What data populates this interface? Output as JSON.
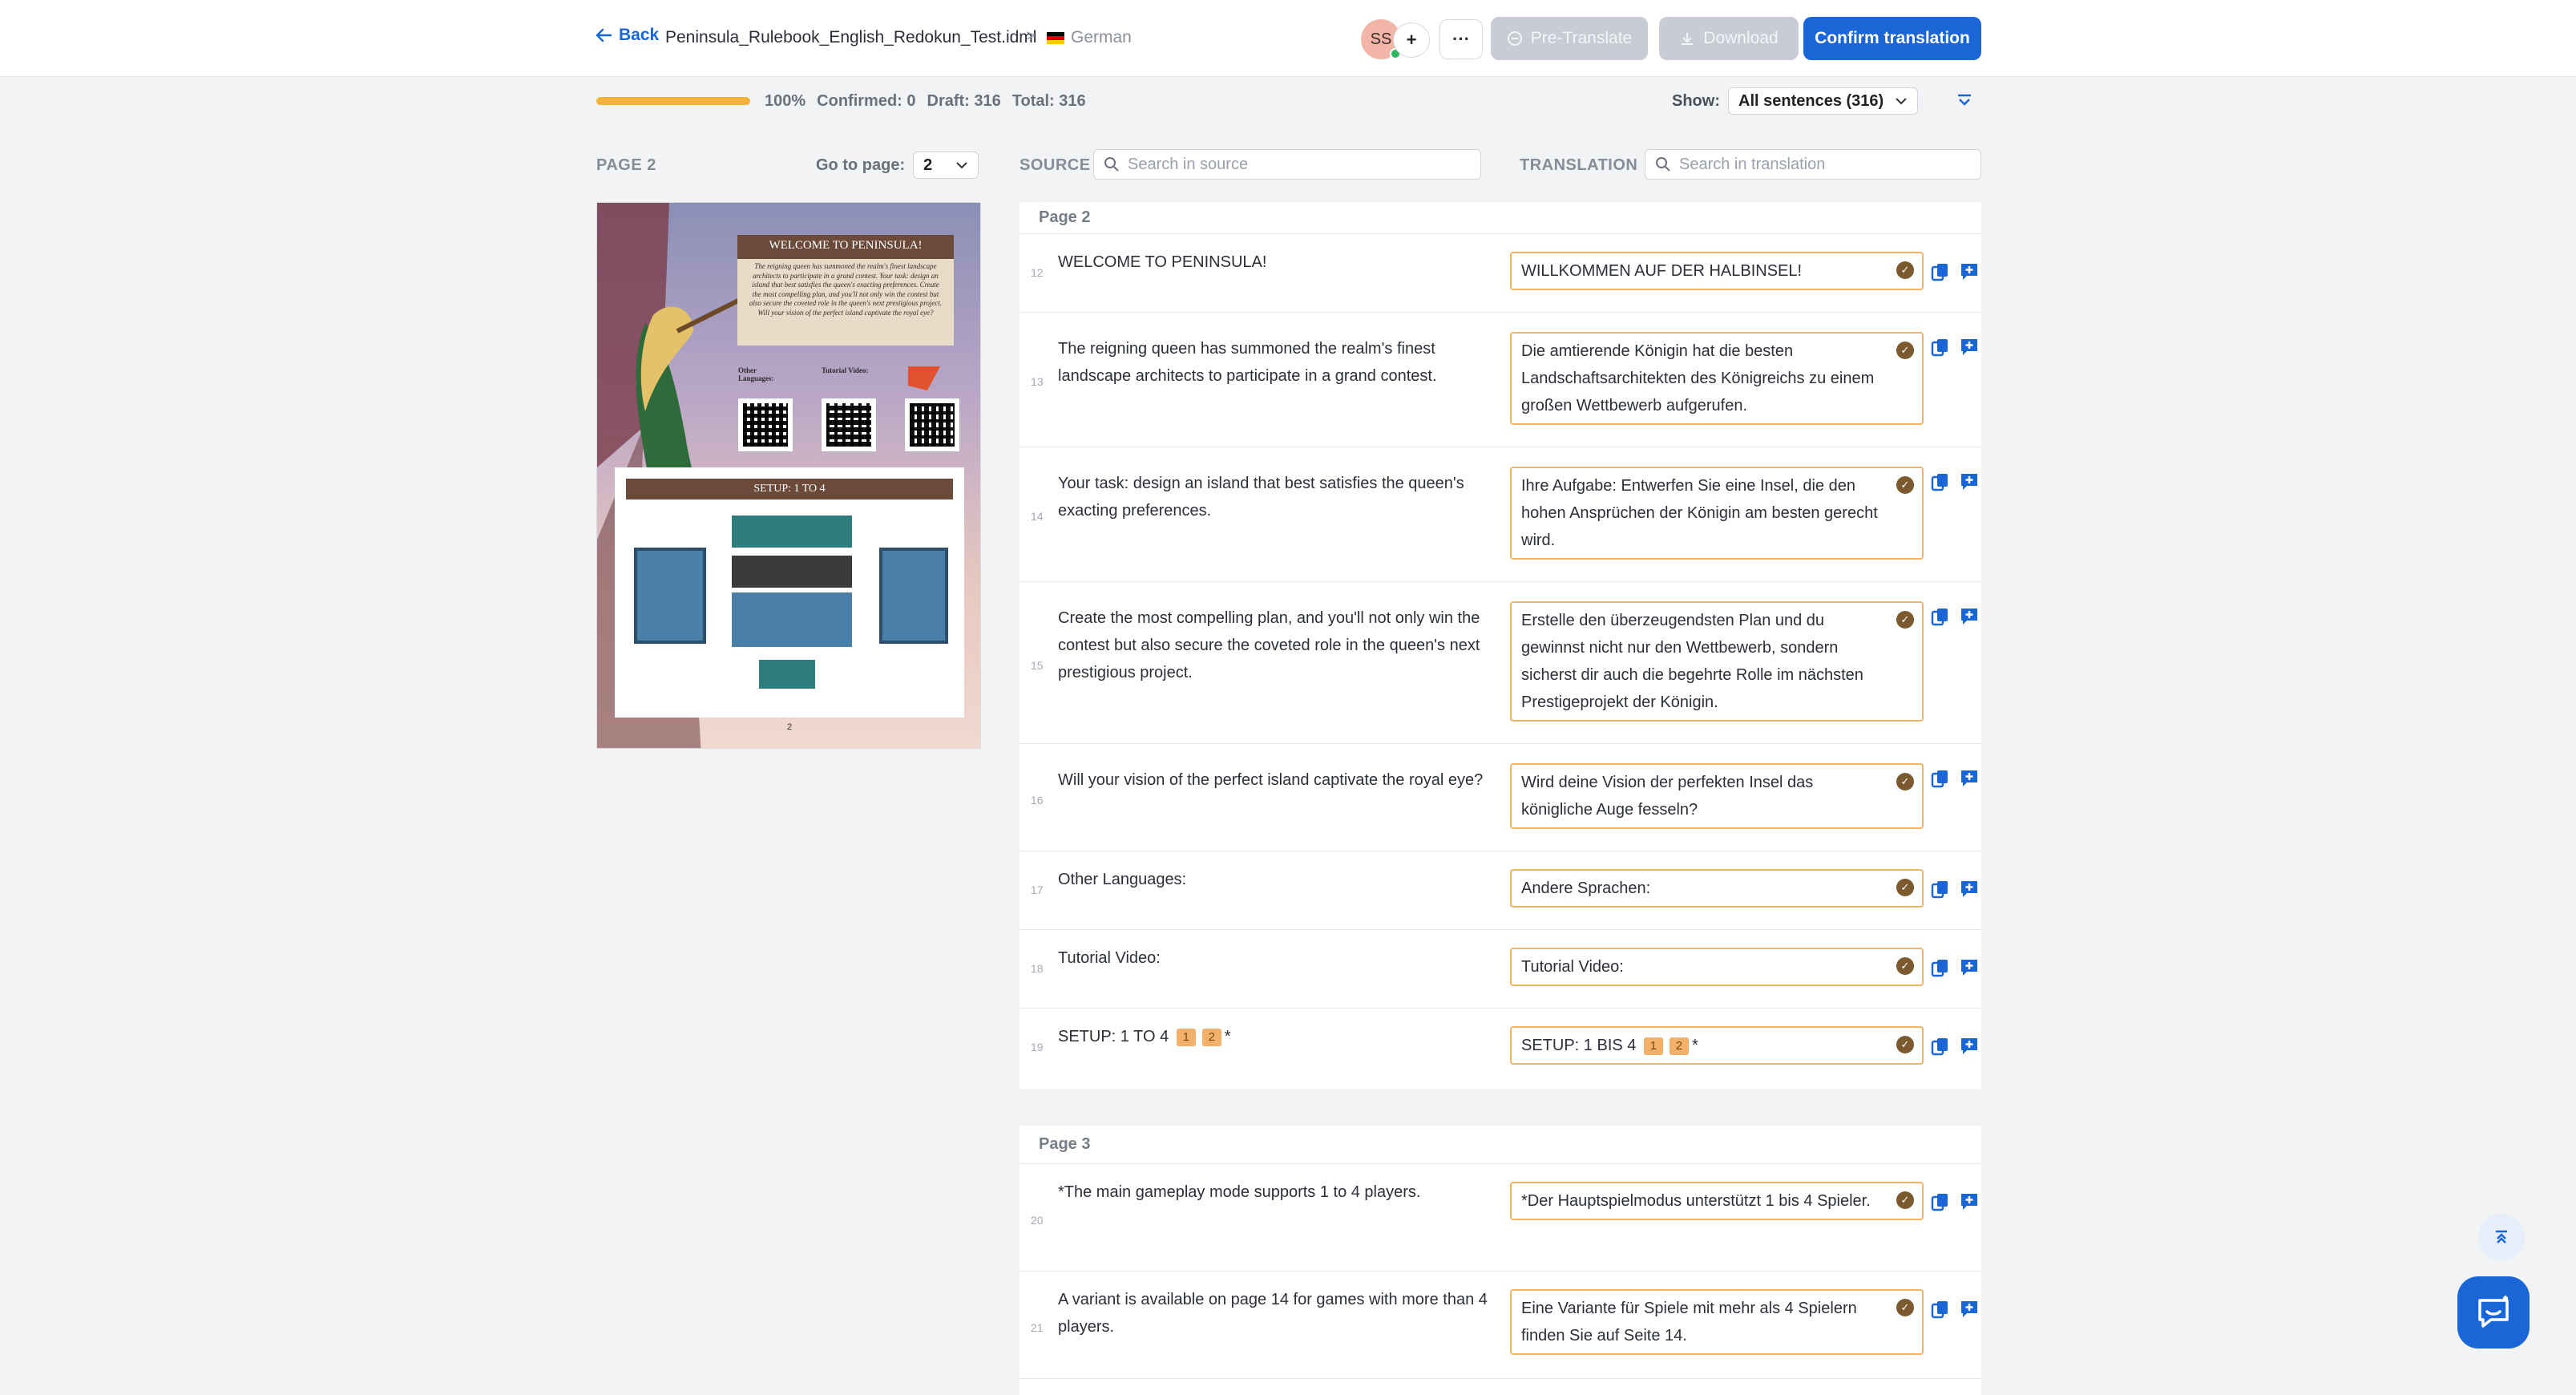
{
  "header": {
    "back_label": "Back",
    "file_name": "Peninsula_Rulebook_English_Redokun_Test.idml",
    "separator": ">",
    "language": "German",
    "avatar_initials": "SS",
    "add_label": "+",
    "more_label": "···",
    "pretranslate_label": "Pre-Translate",
    "download_label": "Download",
    "confirm_label": "Confirm translation"
  },
  "progress": {
    "percent": "100%",
    "value": 1.0,
    "confirmed": "Confirmed: 0",
    "draft": "Draft: 316",
    "total": "Total: 316",
    "show_label": "Show:",
    "show_value": "All sentences (316)"
  },
  "columns": {
    "page_label": "PAGE 2",
    "goto_label": "Go to page:",
    "goto_value": "2",
    "source_label": "SOURCE",
    "source_placeholder": "Search in source",
    "translation_label": "TRANSLATION",
    "translation_placeholder": "Search in translation"
  },
  "preview": {
    "title": "WELCOME TO PENINSULA!",
    "intro": "The reigning queen has summoned the realm's finest landscape architects to participate in a grand contest. Your task: design an island that best satisfies the queen's exacting preferences. Create the most compelling plan, and you'll not only win the contest but also secure the coveted role in the queen's next prestigious project. Will your vision of the perfect island captivate the royal eye?",
    "other_languages": "Other Languages:",
    "tutorial_video": "Tutorial Video:",
    "setup": "SETUP: 1 TO 4",
    "page_number": "2",
    "colors": {
      "sky": "#8b8fb6",
      "banner": "#6b4a3a",
      "card": "#e8dcc8"
    }
  },
  "page2": {
    "label": "Page 2",
    "rows": [
      {
        "num": "12",
        "src": "WELCOME TO PENINSULA!",
        "trans": "WILLKOMMEN AUF DER HALBINSEL!"
      },
      {
        "num": "13",
        "src": "The reigning queen has summoned the realm's finest landscape architects to participate in a grand contest.",
        "trans": "Die amtierende Königin hat die besten Landschaftsarchitekten des Königreichs zu einem großen Wettbewerb aufgerufen."
      },
      {
        "num": "14",
        "src": "Your task: design an island that best satisfies the queen's exacting preferences.",
        "trans": "Ihre Aufgabe: Entwerfen Sie eine Insel, die den hohen Ansprüchen der Königin am besten gerecht wird."
      },
      {
        "num": "15",
        "src": "Create the most compelling plan, and you'll not only win the contest but also secure the coveted role in the queen's next prestigious project.",
        "trans": "Erstelle den überzeugendsten Plan und du gewinnst nicht nur den Wettbewerb, sondern sicherst dir auch die begehrte Rolle im nächsten Prestigeprojekt der Königin."
      },
      {
        "num": "16",
        "src": "Will your vision of the perfect island captivate the royal eye?",
        "trans": "Wird deine Vision der perfekten Insel das königliche Auge fesseln?"
      },
      {
        "num": "17",
        "src": "Other Languages:",
        "trans": "Andere Sprachen:"
      },
      {
        "num": "18",
        "src": "Tutorial Video:",
        "trans": "Tutorial Video:"
      },
      {
        "num": "19",
        "src": "SETUP: 1 TO 4",
        "trans": "SETUP: 1 BIS 4",
        "tag1": "1",
        "tag2": "2",
        "suffix": "*"
      }
    ]
  },
  "page3": {
    "label": "Page 3",
    "rows": [
      {
        "num": "20",
        "src": "*The main gameplay mode supports 1 to 4 players.",
        "trans": "*Der Hauptspielmodus unterstützt 1 bis 4 Spieler."
      },
      {
        "num": "21",
        "src": "A variant is available on page 14 for games with more than 4 players.",
        "trans": "Eine Variante für Spiele mit mehr als 4 Spielern finden Sie auf Seite 14."
      }
    ]
  },
  "icons": {
    "back": "arrow-left-icon",
    "translation_memory": "tm-icon",
    "copy": "copy-source-icon",
    "comment": "add-comment-icon",
    "chat": "chat-support-icon",
    "scroll_top": "scroll-top-icon",
    "filter": "filter-icon"
  },
  "colors": {
    "primary": "#1a66d6",
    "progress": "#f2b33c",
    "draft_border": "#f0b468",
    "disabled": "#c7ccd5"
  }
}
